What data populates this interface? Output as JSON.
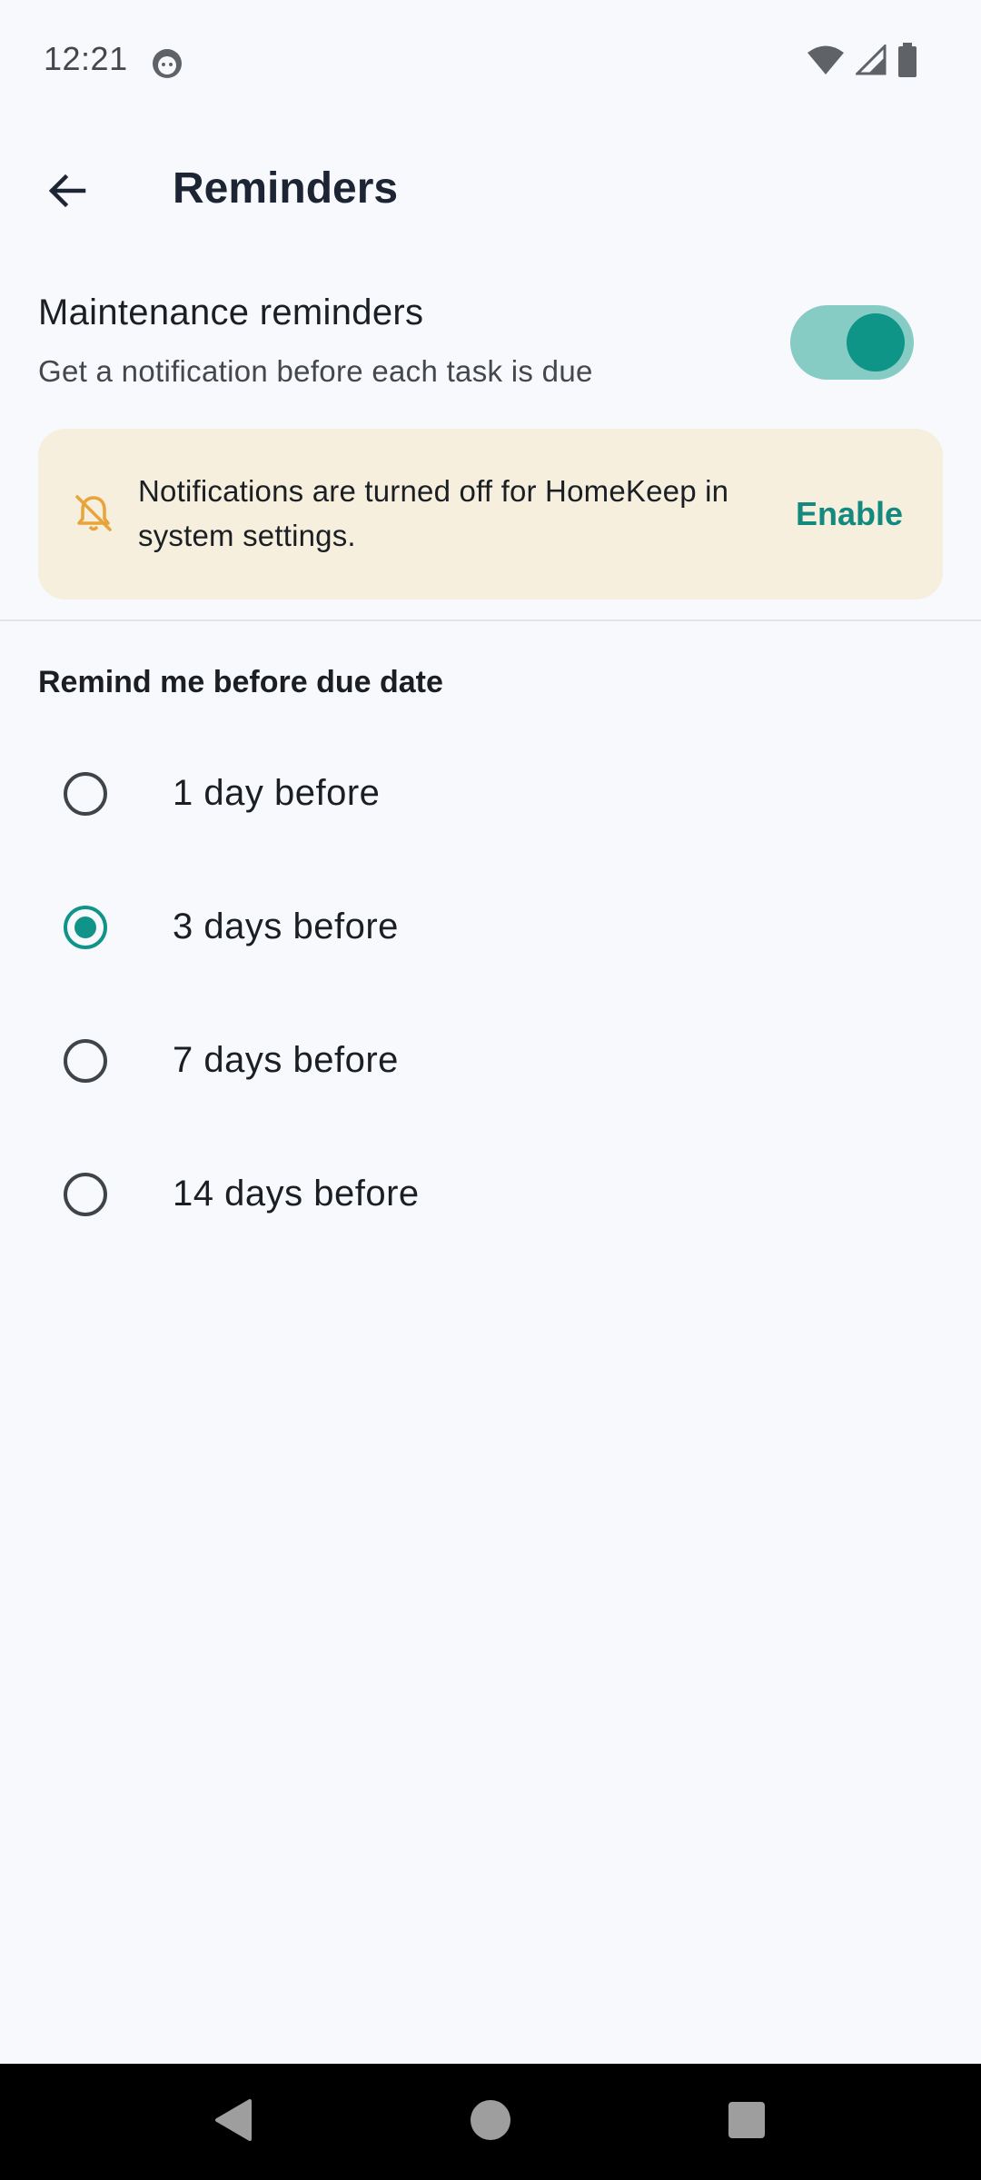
{
  "status_bar": {
    "time": "12:21",
    "icons": [
      "android-face-icon",
      "wifi-icon",
      "cell-signal-icon",
      "battery-icon"
    ]
  },
  "app_bar": {
    "title": "Reminders",
    "back_icon": "arrow-back-icon"
  },
  "master_switch": {
    "title": "Maintenance reminders",
    "subtitle": "Get a notification before each task is due",
    "enabled": true
  },
  "banner": {
    "icon": "notifications-off-icon",
    "message": "Notifications are turned off for HomeKeep in system settings.",
    "action_label": "Enable"
  },
  "section": {
    "header": "Remind me before due date",
    "options": [
      {
        "label": "1 day before",
        "selected": false
      },
      {
        "label": "3 days before",
        "selected": true
      },
      {
        "label": "7 days before",
        "selected": false
      },
      {
        "label": "14 days before",
        "selected": false
      }
    ]
  },
  "colors": {
    "accent": "#10948a",
    "toggle_track": "#86cbc4",
    "banner_bg": "#f6efdd",
    "warning_icon": "#e8a33a",
    "background": "#f7f9fc"
  },
  "nav_bar": {
    "icons": [
      "back-triangle-icon",
      "home-circle-icon",
      "recents-square-icon"
    ]
  }
}
